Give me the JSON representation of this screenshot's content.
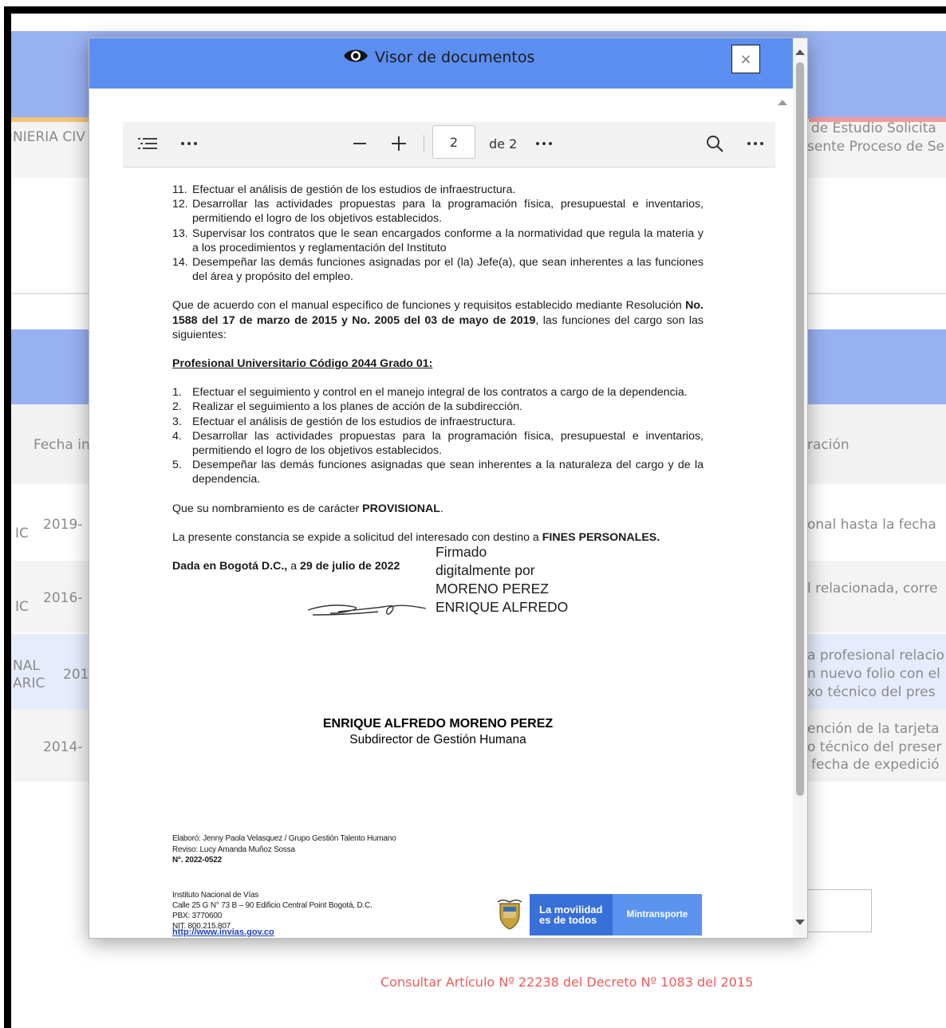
{
  "background": {
    "left_texts": [
      "NIERIA CIV",
      "Fecha in",
      "2019-",
      "IC",
      "2016-",
      "IC",
      "201",
      "NAL",
      "ARIC",
      "2014-"
    ],
    "right_texts": [
      "de Estudio Solicita",
      "sente Proceso de Se",
      "ración",
      "onal hasta la fecha",
      "l relacionada, corre",
      "a profesional relacio",
      "n nuevo folio con el",
      "xo técnico del pres",
      "ención de la tarjeta",
      "o técnico del preser",
      "fecha de expedició"
    ],
    "consult_link": "Consultar Artículo Nº 22238 del Decreto Nº 1083 del 2015"
  },
  "modal": {
    "title": "Visor de documentos",
    "close_label": "×",
    "toolbar": {
      "page_value": "2",
      "page_of": "de 2"
    }
  },
  "document": {
    "list_a": [
      {
        "n": "11.",
        "text": "Efectuar el análisis de gestión de los estudios de infraestructura."
      },
      {
        "n": "12.",
        "text": "Desarrollar las actividades propuestas para la programación física, presupuestal e inventarios, permitiendo el logro de los objetivos establecidos."
      },
      {
        "n": "13.",
        "text": "Supervisar los contratos que le sean encargados conforme a la normatividad que regula la materia y a los procedimientos y reglamentación del Instituto"
      },
      {
        "n": "14.",
        "text": "Desempeñar las demás funciones asignadas por el (la) Jefe(a), que sean inherentes a las funciones del área y propósito del empleo."
      }
    ],
    "para1_a": "Que de acuerdo con el manual específico de funciones y requisitos establecido mediante Resolución ",
    "para1_bold": "No. 1588 del 17 de marzo de 2015 y No. 2005 del 03 de mayo de 2019",
    "para1_c": ", las funciones del cargo son las siguientes:",
    "heading": "Profesional Universitario Código 2044 Grado 01:",
    "list_b": [
      {
        "n": "1.",
        "text": "Efectuar el seguimiento y control en el manejo integral de los contratos a cargo de la dependencia."
      },
      {
        "n": "2.",
        "text": "Realizar el seguimiento a los planes de acción de la subdirección."
      },
      {
        "n": "3.",
        "text": "Efectuar el análisis de gestión de los estudios de infraestructura."
      },
      {
        "n": "4.",
        "text": "Desarrollar las actividades propuestas para la programación física, presupuestal e inventarios, permitiendo el logro de los objetivos establecidos."
      },
      {
        "n": "5.",
        "text": "Desempeñar las demás funciones asignadas que sean inherentes a la naturaleza del cargo y de la dependencia."
      }
    ],
    "para2_a": "Que su nombramiento es de carácter ",
    "para2_bold": "PROVISIONAL",
    "para2_c": ".",
    "para3_a": "La presente constancia se expide a solicitud del interesado con destino a ",
    "para3_bold": "FINES PERSONALES.",
    "para4_a": "Dada en Bogotá D.C.,",
    "para4_b": " a ",
    "para4_c": "29 de julio de 2022",
    "signature_stamp": [
      "Firmado",
      "digitalmente por",
      "MORENO PEREZ",
      "ENRIQUE ALFREDO"
    ],
    "signer_name": "ENRIQUE ALFREDO MORENO PEREZ",
    "signer_title": "Subdirector de Gestión Humana",
    "elaboro": "Elaboró: Jenny Paola Velasquez / Grupo Gestión Talento Humano",
    "reviso": "Reviso:  Lucy Amanda Muñoz Sossa",
    "numero": "N°. 2022-0522",
    "inst_name": "Instituto Nacional de Vías",
    "inst_addr": "Calle 25 G N° 73 B – 90 Edificio Central Point Bogotá, D.C.",
    "inst_pbx": "PBX: 3770600",
    "inst_nit": "NIT. 800.215.807",
    "web": "http://www.invias.gov.co",
    "logo_line1": "La movilidad",
    "logo_line2": "es de todos",
    "logo_ministry": "Mintransporte"
  },
  "colors": {
    "modal_header": "#5b8ef0",
    "bg_band": "#98b1f0",
    "link_red": "#ef5b5b"
  },
  "icons": [
    "eye-icon",
    "toc-icon",
    "more-icon",
    "zoom-out-icon",
    "zoom-in-icon",
    "search-icon"
  ]
}
